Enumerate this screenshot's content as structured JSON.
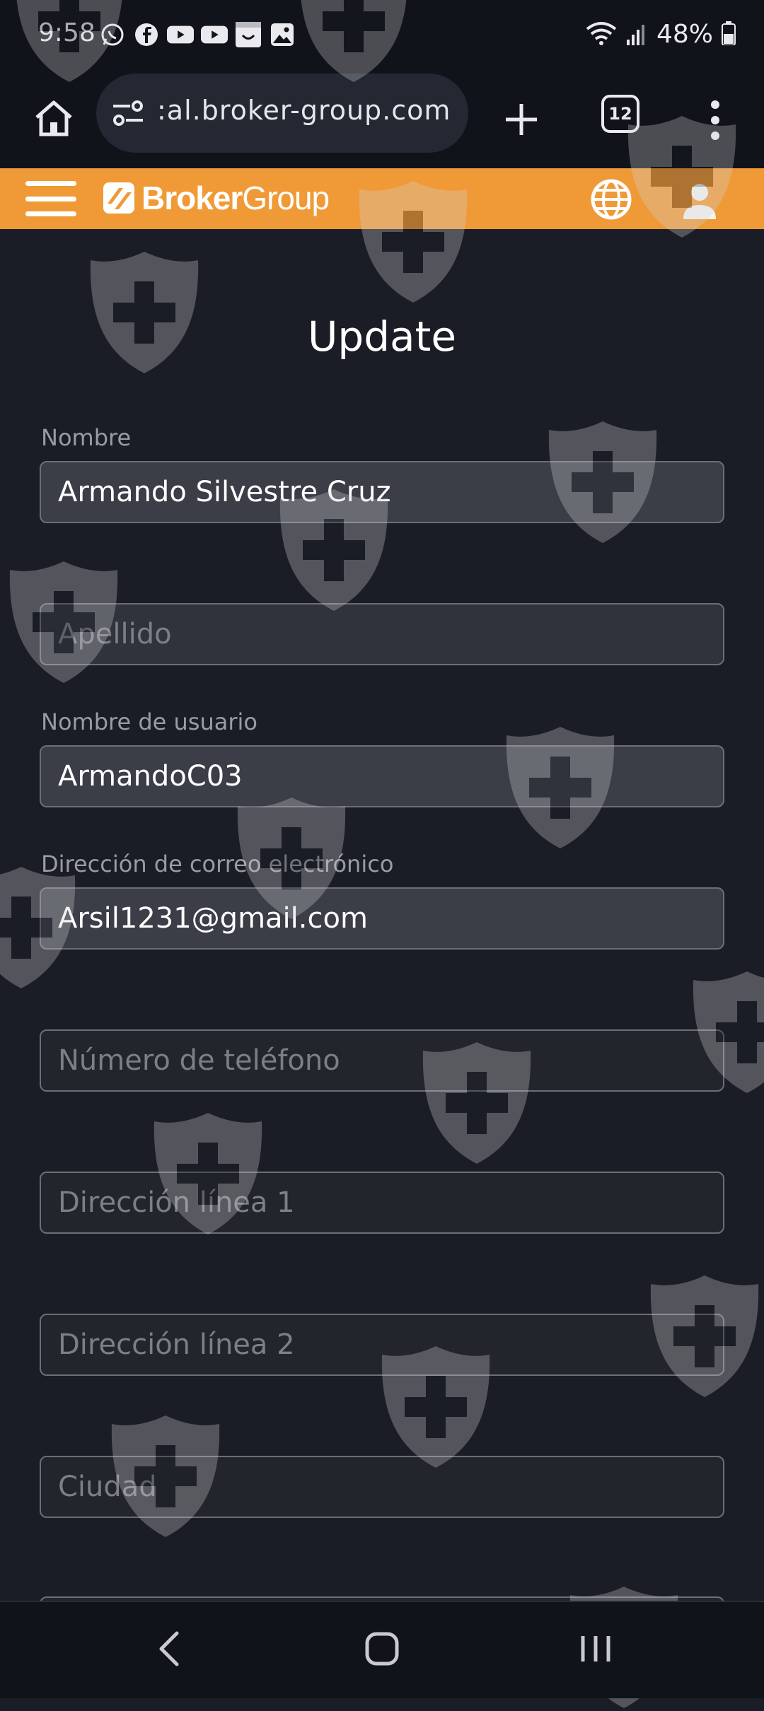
{
  "status_bar": {
    "time": "9:58",
    "battery": "48%",
    "icons": [
      "whatsapp-icon",
      "facebook-icon",
      "youtube-icon",
      "youtube-icon",
      "smile-app-icon",
      "gallery-icon",
      "wifi-icon",
      "signal-icon",
      "battery-icon"
    ]
  },
  "browser": {
    "url": ":al.broker-group.com",
    "tab_count": "12"
  },
  "app_header": {
    "logo_bold": "Broker",
    "logo_light": "Group",
    "color": "#f09a37"
  },
  "page": {
    "title": "Update"
  },
  "form": {
    "nombre": {
      "label": "Nombre",
      "value": "Armando Silvestre Cruz"
    },
    "apellido": {
      "placeholder": "Apellido"
    },
    "usuario": {
      "label": "Nombre de usuario",
      "value": "ArmandoC03"
    },
    "email": {
      "label": "Dirección de correo electrónico",
      "value": "Arsil1231@gmail.com"
    },
    "telefono": {
      "placeholder": "Número de teléfono"
    },
    "direccion1": {
      "placeholder": "Dirección línea 1"
    },
    "direccion2": {
      "placeholder": "Dirección línea 2"
    },
    "ciudad": {
      "placeholder": "Ciudad"
    }
  },
  "colors": {
    "background": "#1b1d26",
    "bar": "#10131a"
  }
}
